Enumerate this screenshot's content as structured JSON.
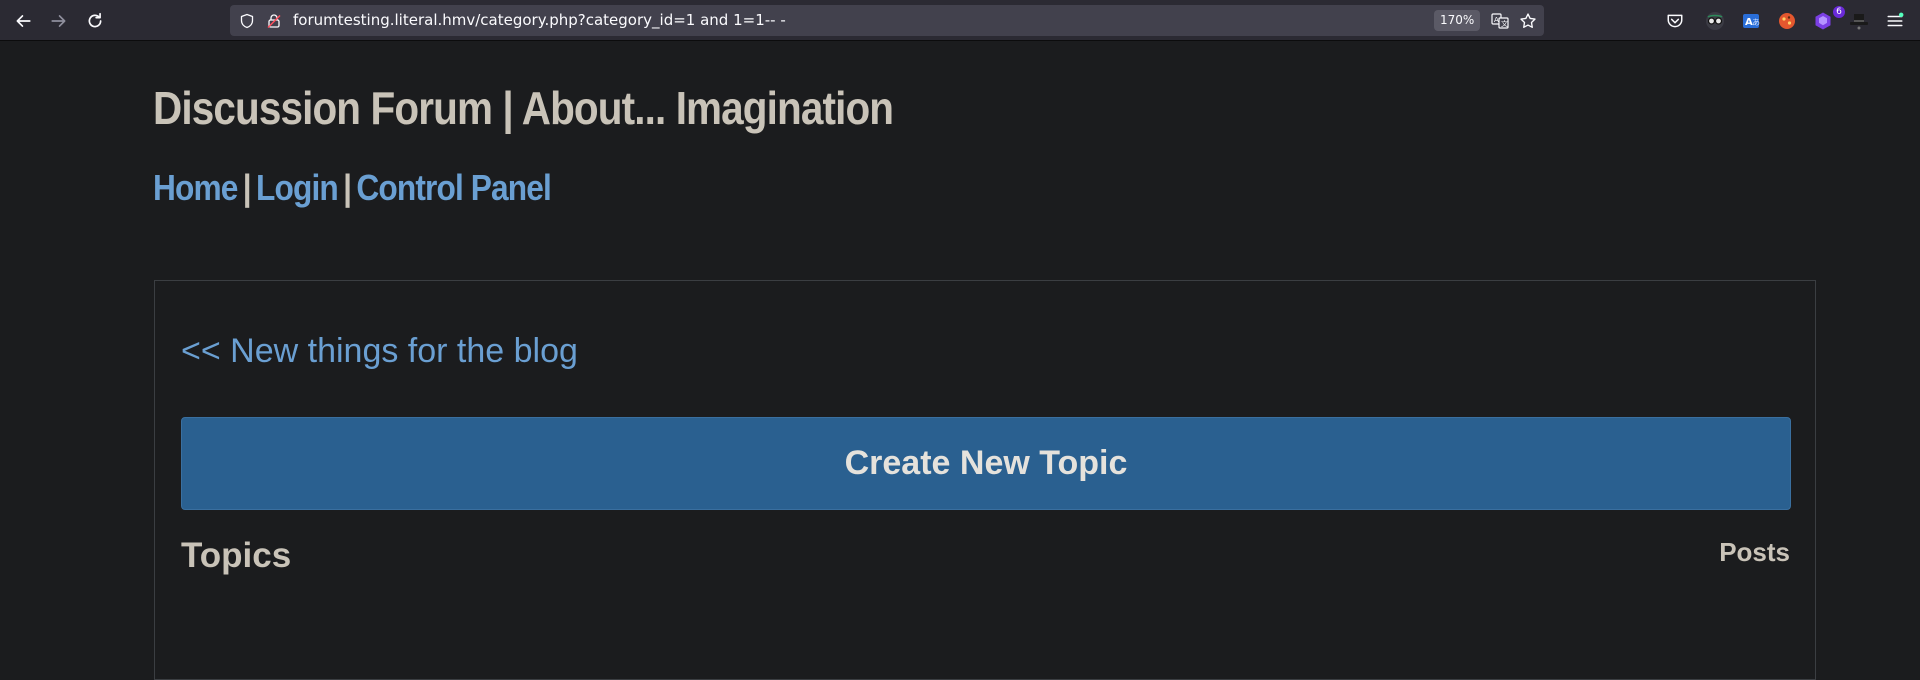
{
  "browser": {
    "url": "forumtesting.literal.hmv/category.php?category_id=1 and 1=1-- -",
    "zoom": "170%",
    "extension_badge": "6",
    "icons": {
      "back": "arrow-left-icon",
      "forward": "arrow-right-icon",
      "reload": "reload-icon",
      "tracking_protection": "shield-icon",
      "connection": "insecure-lock-icon",
      "translate": "translate-icon",
      "bookmark": "star-icon",
      "pocket": "pocket-icon",
      "menu": "hamburger-menu-icon"
    }
  },
  "site": {
    "title": "Discussion Forum | About... Imagination",
    "nav": {
      "home": "Home",
      "login": "Login",
      "control_panel": "Control Panel",
      "separator": "|"
    }
  },
  "main": {
    "back_link": "<< New things for the blog",
    "create_button": "Create New Topic",
    "topics_heading": "Topics",
    "posts_heading": "Posts"
  },
  "colors": {
    "page_bg": "#1b1c1e",
    "link": "#6a9fd2",
    "text": "#c9c3b8",
    "button": "#2a6090"
  }
}
